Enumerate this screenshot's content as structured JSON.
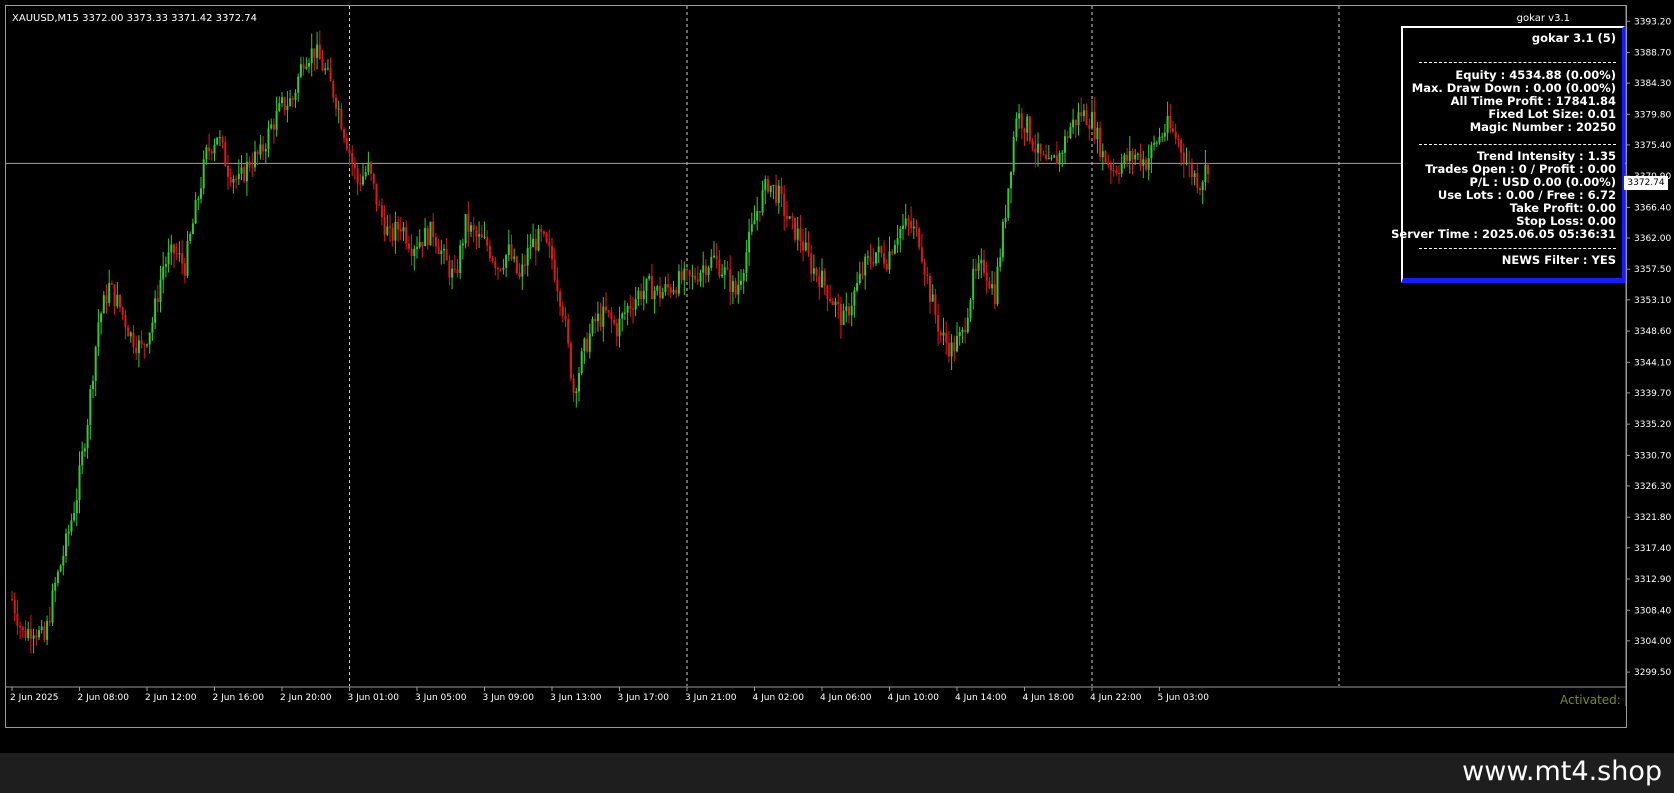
{
  "header": {
    "symbol_label": "XAUUSD,M15  3372.00 3373.33 3371.42 3372.74",
    "ea_label": "gokar v3.1"
  },
  "panel": {
    "title": "gokar 3.1 (5)",
    "equity": "Equity : 4534.88 (0.00%)",
    "max_dd": "Max. Draw Down : 0.00 (0.00%)",
    "all_time": "All Time Profit : 17841.84",
    "lot_size": "Fixed Lot Size: 0.01",
    "magic": "Magic Number : 20250",
    "trend": "Trend Intensity : 1.35",
    "trades": "Trades Open : 0 / Profit : 0.00",
    "pl": "P/L : USD 0.00 (0.00%)",
    "lots": "Use Lots : 0.00 / Free : 6.72",
    "tp": "Take Profit: 0.00",
    "sl": "Stop Loss: 0.00",
    "server_time": "Server Time : 2025.06.05 05:36:31",
    "news": "NEWS Filter : YES"
  },
  "activated_label": "Activated:",
  "current_price": "3372.74",
  "watermark": "www.mt4.shop",
  "colors": {
    "bull": "#2ecc2e",
    "bear": "#e01818",
    "axis": "#9a9a9a",
    "panel_border": "#1a1aff"
  },
  "chart_data": {
    "type": "candlestick",
    "symbol": "XAUUSD",
    "timeframe": "M15",
    "ylim": [
      3297.5,
      3395.4
    ],
    "y_ticks": [
      "3393.20",
      "3388.70",
      "3384.30",
      "3379.80",
      "3375.40",
      "3370.90",
      "3366.40",
      "3362.00",
      "3357.50",
      "3353.10",
      "3348.60",
      "3344.10",
      "3339.70",
      "3335.20",
      "3330.70",
      "3326.30",
      "3321.80",
      "3317.40",
      "3312.90",
      "3308.40",
      "3304.00",
      "3299.50"
    ],
    "x_ticks": [
      "2 Jun 2025",
      "2 Jun 08:00",
      "2 Jun 12:00",
      "2 Jun 16:00",
      "2 Jun 20:00",
      "3 Jun 01:00",
      "3 Jun 05:00",
      "3 Jun 09:00",
      "3 Jun 13:00",
      "3 Jun 17:00",
      "3 Jun 21:00",
      "4 Jun 02:00",
      "4 Jun 06:00",
      "4 Jun 10:00",
      "4 Jun 14:00",
      "4 Jun 18:00",
      "4 Jun 22:00",
      "5 Jun 03:00"
    ],
    "day_separators": [
      "3 Jun 01:00",
      "3 Jun 21:00",
      "4 Jun 22:00"
    ],
    "bid_line": 3372.74,
    "close_path": [
      [
        0,
        3310
      ],
      [
        4,
        3305
      ],
      [
        8,
        3306
      ],
      [
        12,
        3304
      ],
      [
        16,
        3312
      ],
      [
        20,
        3318
      ],
      [
        24,
        3325
      ],
      [
        28,
        3336
      ],
      [
        32,
        3350
      ],
      [
        36,
        3355
      ],
      [
        40,
        3352
      ],
      [
        44,
        3348
      ],
      [
        48,
        3346
      ],
      [
        52,
        3350
      ],
      [
        56,
        3358
      ],
      [
        60,
        3360
      ],
      [
        64,
        3358
      ],
      [
        68,
        3366
      ],
      [
        72,
        3374
      ],
      [
        76,
        3377
      ],
      [
        80,
        3372
      ],
      [
        84,
        3370
      ],
      [
        88,
        3373
      ],
      [
        92,
        3374
      ],
      [
        96,
        3378
      ],
      [
        100,
        3381
      ],
      [
        104,
        3382
      ],
      [
        108,
        3388
      ],
      [
        112,
        3389
      ],
      [
        116,
        3386
      ],
      [
        120,
        3382
      ],
      [
        124,
        3376
      ],
      [
        128,
        3370
      ],
      [
        132,
        3372
      ],
      [
        136,
        3366
      ],
      [
        140,
        3362
      ],
      [
        144,
        3364
      ],
      [
        148,
        3361
      ],
      [
        152,
        3362
      ],
      [
        156,
        3363
      ],
      [
        160,
        3359
      ],
      [
        164,
        3356
      ],
      [
        168,
        3364
      ],
      [
        172,
        3362
      ],
      [
        176,
        3361
      ],
      [
        180,
        3358
      ],
      [
        184,
        3360
      ],
      [
        188,
        3356
      ],
      [
        192,
        3361
      ],
      [
        196,
        3362
      ],
      [
        200,
        3359
      ],
      [
        204,
        3352
      ],
      [
        208,
        3340
      ],
      [
        212,
        3346
      ],
      [
        216,
        3350
      ],
      [
        220,
        3351
      ],
      [
        224,
        3349
      ],
      [
        228,
        3352
      ],
      [
        232,
        3354
      ],
      [
        236,
        3355
      ],
      [
        240,
        3354
      ],
      [
        244,
        3355
      ],
      [
        248,
        3356
      ],
      [
        252,
        3356
      ],
      [
        256,
        3358
      ],
      [
        260,
        3359
      ],
      [
        264,
        3357
      ],
      [
        268,
        3354
      ],
      [
        272,
        3360
      ],
      [
        276,
        3366
      ],
      [
        280,
        3370
      ],
      [
        284,
        3368
      ],
      [
        288,
        3364
      ],
      [
        292,
        3362
      ],
      [
        296,
        3358
      ],
      [
        300,
        3356
      ],
      [
        304,
        3353
      ],
      [
        308,
        3350
      ],
      [
        312,
        3354
      ],
      [
        316,
        3358
      ],
      [
        320,
        3360
      ],
      [
        324,
        3359
      ],
      [
        328,
        3363
      ],
      [
        332,
        3364
      ],
      [
        336,
        3362
      ],
      [
        340,
        3354
      ],
      [
        344,
        3348
      ],
      [
        348,
        3346
      ],
      [
        352,
        3348
      ],
      [
        356,
        3356
      ],
      [
        360,
        3358
      ],
      [
        364,
        3354
      ],
      [
        368,
        3366
      ],
      [
        372,
        3380
      ],
      [
        376,
        3378
      ],
      [
        380,
        3374
      ],
      [
        384,
        3372
      ],
      [
        388,
        3374
      ],
      [
        392,
        3378
      ],
      [
        396,
        3380
      ],
      [
        400,
        3379
      ],
      [
        404,
        3374
      ],
      [
        408,
        3372
      ],
      [
        412,
        3373
      ],
      [
        416,
        3374
      ],
      [
        420,
        3373
      ],
      [
        424,
        3376
      ],
      [
        428,
        3378
      ],
      [
        432,
        3376
      ],
      [
        436,
        3372
      ],
      [
        440,
        3370
      ],
      [
        443,
        3372.74
      ]
    ]
  }
}
